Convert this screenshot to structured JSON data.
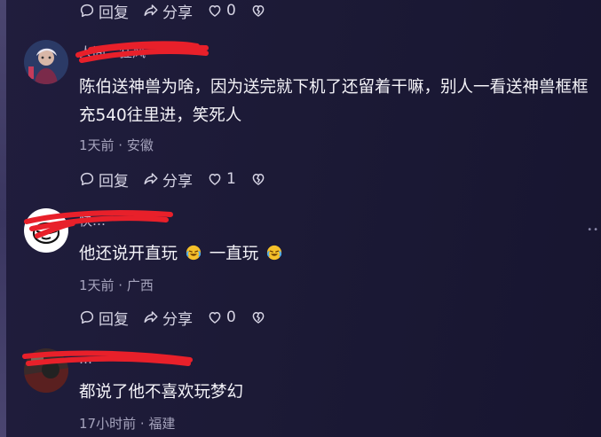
{
  "actions": {
    "reply": "回复",
    "share": "分享"
  },
  "top_actions": {
    "like_count": "0"
  },
  "comments": [
    {
      "username": "人间…狂风",
      "text": "陈伯送神兽为啥，因为送完就下机了还留着干嘛，别人一看送神兽框框充540往里进，笑死人",
      "meta": "1天前 · 安徽",
      "like_count": "1"
    },
    {
      "username": "快…",
      "text_parts": [
        "他还说开直玩",
        "一直玩"
      ],
      "meta": "1天前 · 广西",
      "like_count": "0"
    },
    {
      "username": "…",
      "text": "都说了他不喜欢玩梦幻",
      "meta": "17小时前 · 福建"
    }
  ],
  "icons": [
    "comment-icon",
    "share-icon",
    "heart-icon",
    "broken-heart-icon",
    "laughing-emoji-icon",
    "more-dots-icon"
  ],
  "colors": {
    "background": "#1c1a36",
    "redaction": "#e8202a",
    "text": "#f4f3f8",
    "meta": "#a6a4bd"
  }
}
